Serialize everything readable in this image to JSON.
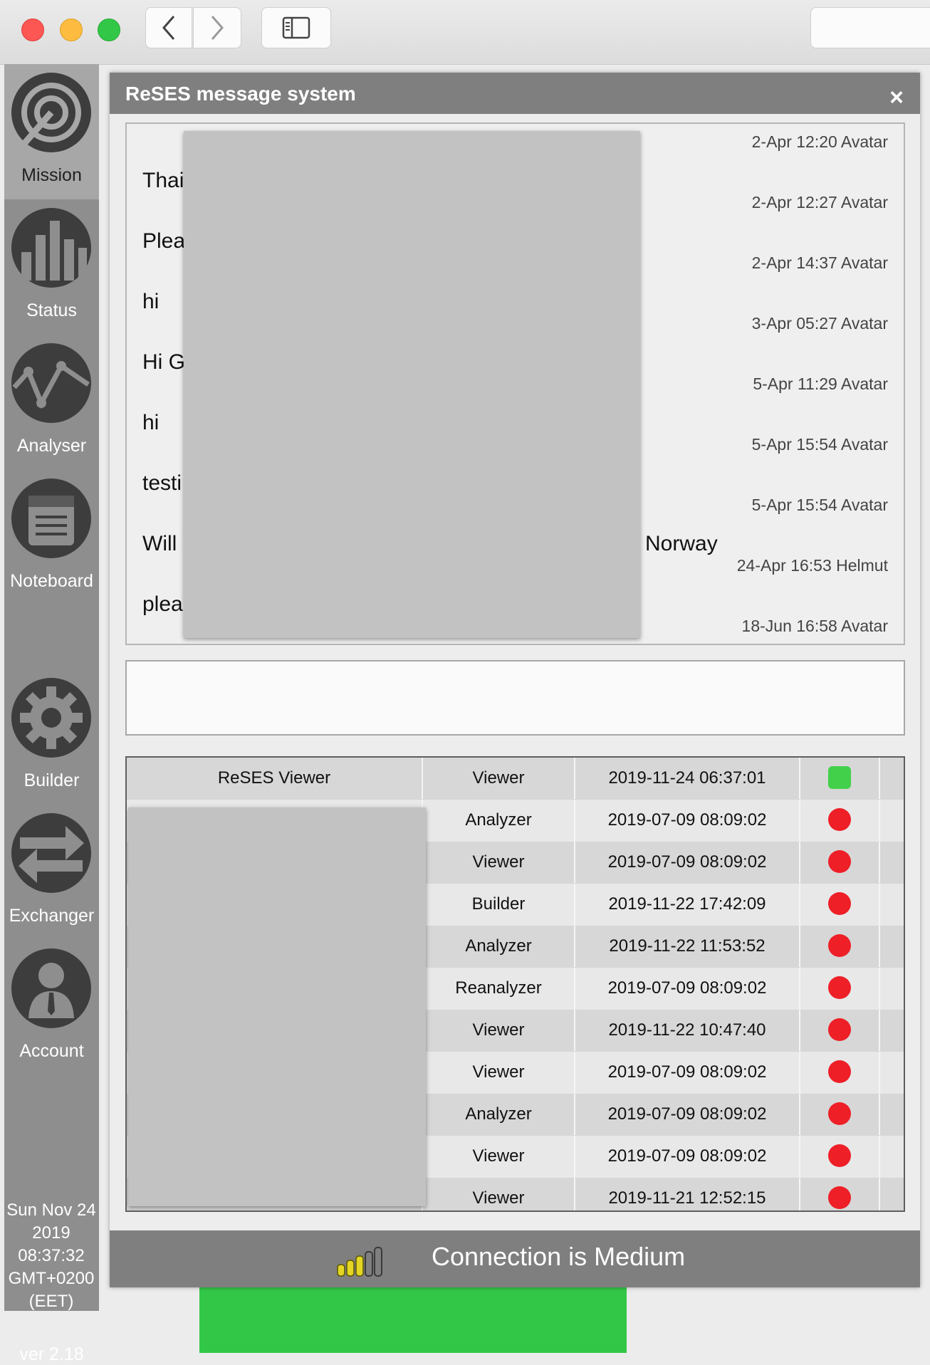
{
  "browser": {
    "back_icon": "chevron-left-icon",
    "forward_icon": "chevron-right-icon",
    "sidebar_icon": "sidebar-icon"
  },
  "nav": {
    "items": [
      {
        "label": "Mission",
        "icon": "target-icon",
        "active": true
      },
      {
        "label": "Status",
        "icon": "bar-chart-icon",
        "active": false
      },
      {
        "label": "Analyser",
        "icon": "pulse-icon",
        "active": false
      },
      {
        "label": "Noteboard",
        "icon": "notepad-icon",
        "active": false
      },
      {
        "label": "Builder",
        "icon": "gear-icon",
        "active": false
      },
      {
        "label": "Exchanger",
        "icon": "exchange-icon",
        "active": false
      },
      {
        "label": "Account",
        "icon": "user-icon",
        "active": false
      }
    ],
    "datetime": "Sun Nov 24 2019 08:37:32 GMT+0200 (EET)",
    "version": "ver 2.18"
  },
  "modal": {
    "title": "ReSES message system",
    "close_label": "×",
    "messages": [
      {
        "text": "Thai",
        "meta": "2-Apr 12:20 Avatar"
      },
      {
        "text": "Plea",
        "meta": "2-Apr 12:27 Avatar"
      },
      {
        "text": "hi",
        "meta": "2-Apr 14:37 Avatar"
      },
      {
        "text": "Hi G",
        "meta": "3-Apr 05:27 Avatar"
      },
      {
        "text": "hi",
        "meta": "5-Apr 11:29 Avatar"
      },
      {
        "text": "testi",
        "meta": "5-Apr 15:54 Avatar"
      },
      {
        "text": "Will",
        "meta": "5-Apr 15:54 Avatar",
        "text_right": "Norway"
      },
      {
        "text": "plea",
        "meta": "24-Apr 16:53 Helmut"
      },
      {
        "text": "",
        "meta": "18-Jun 16:58 Avatar"
      }
    ],
    "input_value": "",
    "users": [
      {
        "name": "ReSES Viewer",
        "role": "Viewer",
        "last_seen": "2019-11-24 06:37:01",
        "online": true
      },
      {
        "name": "",
        "role": "Analyzer",
        "last_seen": "2019-07-09 08:09:02",
        "online": false
      },
      {
        "name": "",
        "role": "Viewer",
        "last_seen": "2019-07-09 08:09:02",
        "online": false
      },
      {
        "name": "",
        "role": "Builder",
        "last_seen": "2019-11-22 17:42:09",
        "online": false
      },
      {
        "name": "",
        "role": "Analyzer",
        "last_seen": "2019-11-22 11:53:52",
        "online": false
      },
      {
        "name": "",
        "role": "Reanalyzer",
        "last_seen": "2019-07-09 08:09:02",
        "online": false
      },
      {
        "name": "",
        "role": "Viewer",
        "last_seen": "2019-11-22 10:47:40",
        "online": false
      },
      {
        "name": "",
        "role": "Viewer",
        "last_seen": "2019-07-09 08:09:02",
        "online": false
      },
      {
        "name": "",
        "role": "Analyzer",
        "last_seen": "2019-07-09 08:09:02",
        "online": false
      },
      {
        "name": "",
        "role": "Viewer",
        "last_seen": "2019-07-09 08:09:02",
        "online": false
      },
      {
        "name": "",
        "role": "Viewer",
        "last_seen": "2019-11-21 12:52:15",
        "online": false
      }
    ],
    "footer": {
      "connection_text": "Connection is Medium",
      "signal_icon": "signal-strength-icon",
      "signal_level": 3,
      "signal_max": 5
    }
  },
  "colors": {
    "online": "#42d04b",
    "offline": "#ee1f27",
    "header_bg": "#7f7f7f",
    "nav_bg": "#8e8e8e"
  }
}
